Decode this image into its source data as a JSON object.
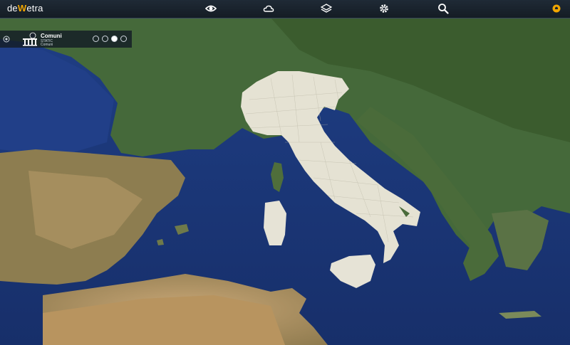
{
  "app": {
    "logo_prefix": "de",
    "logo_mark": "W",
    "logo_suffix": "etra"
  },
  "toolbar": [
    {
      "name": "view-icon"
    },
    {
      "name": "weather-icon"
    },
    {
      "name": "layers-icon"
    },
    {
      "name": "settings-icon"
    },
    {
      "name": "search-icon"
    }
  ],
  "layer": {
    "title": "Comuni",
    "subtitle": "STATIC",
    "description": "Comuni"
  },
  "colors": {
    "topbar": "#1a232e",
    "accent": "#f0a500",
    "sea": "#1f3f86",
    "land": "#4a6b35"
  }
}
